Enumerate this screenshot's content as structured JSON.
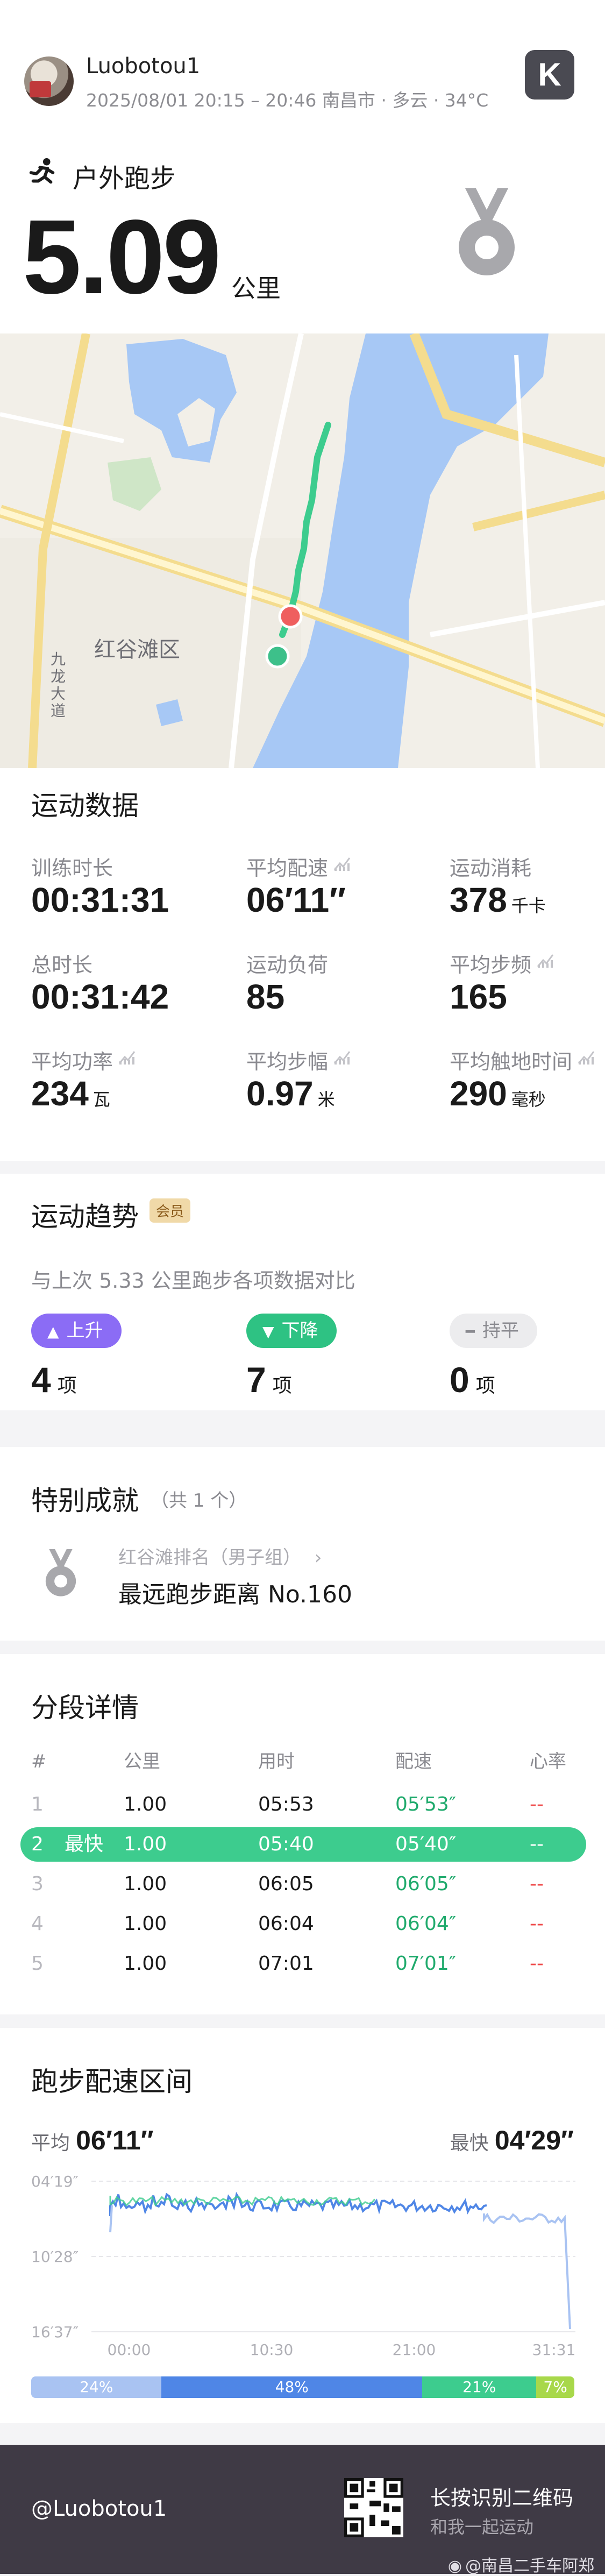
{
  "header": {
    "username": "Luobotou1",
    "meta": "2025/08/01 20:15 – 20:46 南昌市 · 多云 · 34°C",
    "app_logo": "K"
  },
  "activity": {
    "sport": "户外跑步",
    "distance": "5.09",
    "distance_unit": "公里"
  },
  "map": {
    "district": "红谷滩区",
    "road": "九龙大道"
  },
  "stats": {
    "title": "运动数据",
    "items": [
      {
        "label": "训练时长",
        "value": "00:31:31",
        "unit": "",
        "trend": false
      },
      {
        "label": "平均配速",
        "value": "06′11″",
        "unit": "",
        "trend": true
      },
      {
        "label": "运动消耗",
        "value": "378",
        "unit": "千卡",
        "trend": false
      },
      {
        "label": "总时长",
        "value": "00:31:42",
        "unit": "",
        "trend": false
      },
      {
        "label": "运动负荷",
        "value": "85",
        "unit": "",
        "trend": false
      },
      {
        "label": "平均步频",
        "value": "165",
        "unit": "",
        "trend": true
      },
      {
        "label": "平均功率",
        "value": "234",
        "unit": "瓦",
        "trend": true
      },
      {
        "label": "平均步幅",
        "value": "0.97",
        "unit": "米",
        "trend": true
      },
      {
        "label": "平均触地时间",
        "value": "290",
        "unit": "毫秒",
        "trend": true
      }
    ]
  },
  "trends": {
    "title": "运动趋势",
    "vip_badge": "会员",
    "compare_text": "与上次 5.33 公里跑步各项数据对比",
    "up_label": "上升",
    "up_count": "4",
    "down_label": "下降",
    "down_count": "7",
    "flat_label": "持平",
    "flat_count": "0",
    "count_unit": "项"
  },
  "achievements": {
    "title": "特别成就",
    "count_text": "（共 1 个）",
    "item_sub": "红谷滩排名（男子组）",
    "item_main": "最远跑步距离 No.160"
  },
  "splits": {
    "title": "分段详情",
    "headers": [
      "#",
      "公里",
      "用时",
      "配速",
      "心率"
    ],
    "fastest_label": "最快",
    "rows": [
      {
        "idx": "1",
        "km": "1.00",
        "time": "05:53",
        "pace": "05′53″",
        "hr": "--",
        "fastest": false
      },
      {
        "idx": "2",
        "km": "1.00",
        "time": "05:40",
        "pace": "05′40″",
        "hr": "--",
        "fastest": true
      },
      {
        "idx": "3",
        "km": "1.00",
        "time": "06:05",
        "pace": "06′05″",
        "hr": "--",
        "fastest": false
      },
      {
        "idx": "4",
        "km": "1.00",
        "time": "06:04",
        "pace": "06′04″",
        "hr": "--",
        "fastest": false
      },
      {
        "idx": "5",
        "km": "1.00",
        "time": "07:01",
        "pace": "07′01″",
        "hr": "--",
        "fastest": false
      }
    ]
  },
  "pace_zone": {
    "title": "跑步配速区间",
    "avg_label": "平均",
    "avg_value": "06′11″",
    "fast_label": "最快",
    "fast_value": "04′29″",
    "y_ticks": [
      "04′19″",
      "10′28″",
      "16′37″"
    ],
    "x_ticks": [
      "00:00",
      "10:30",
      "21:00",
      "31:31"
    ],
    "zones": [
      {
        "pct": "24%",
        "value": 24,
        "color": "#a9c3f2"
      },
      {
        "pct": "48%",
        "value": 48,
        "color": "#4f86e6"
      },
      {
        "pct": "21%",
        "value": 21,
        "color": "#3dcc8e"
      },
      {
        "pct": "7%",
        "value": 7,
        "color": "#a8d84a"
      }
    ]
  },
  "footer": {
    "handle": "@Luobotou1",
    "qr_title": "长按识别二维码",
    "qr_sub": "和我一起运动",
    "watermark": "@南昌二手车阿郑"
  }
}
